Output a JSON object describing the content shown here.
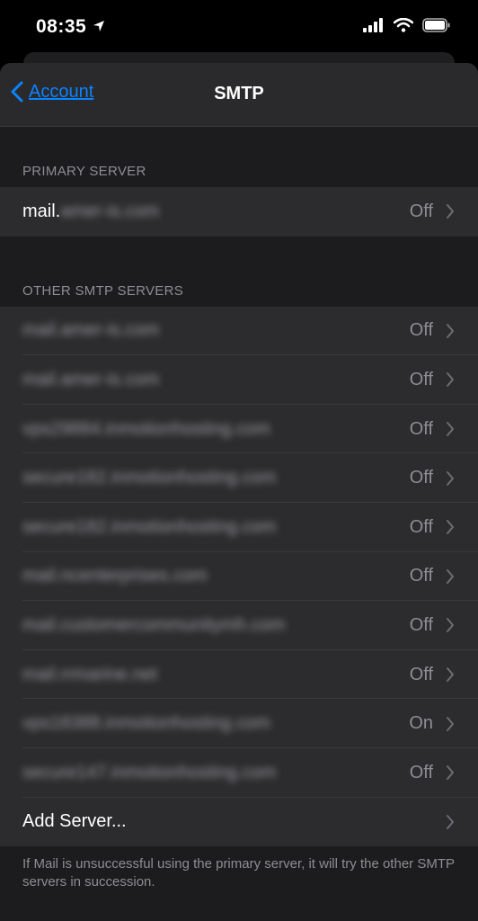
{
  "status_bar": {
    "time": "08:35"
  },
  "nav": {
    "back_label": "Account",
    "title": "SMTP"
  },
  "primary": {
    "header": "PRIMARY SERVER",
    "server": {
      "prefix": "mail.",
      "blurred": "amer-is.com",
      "status": "Off"
    }
  },
  "others": {
    "header": "OTHER SMTP SERVERS",
    "servers": [
      {
        "host": "mail.amer-is.com",
        "status": "Off"
      },
      {
        "host": "mail.amer-is.com",
        "status": "Off"
      },
      {
        "host": "vps29884.inmotionhosting.com",
        "status": "Off"
      },
      {
        "host": "secure182.inmotionhosting.com",
        "status": "Off"
      },
      {
        "host": "secure182.inmotionhosting.com",
        "status": "Off"
      },
      {
        "host": "mail.ncenterprises.com",
        "status": "Off"
      },
      {
        "host": "mail.customercommunitymh.com",
        "status": "Off"
      },
      {
        "host": "mail.rrmarine.net",
        "status": "Off"
      },
      {
        "host": "vps18388.inmotionhosting.com",
        "status": "On"
      },
      {
        "host": "secure147.inmotionhosting.com",
        "status": "Off"
      }
    ],
    "add_label": "Add Server..."
  },
  "footer": "If Mail is unsuccessful using the primary server, it will try the other SMTP servers in succession.",
  "colors": {
    "accent": "#0a84ff",
    "background": "#1c1c1e",
    "cell": "#2c2c2e"
  }
}
